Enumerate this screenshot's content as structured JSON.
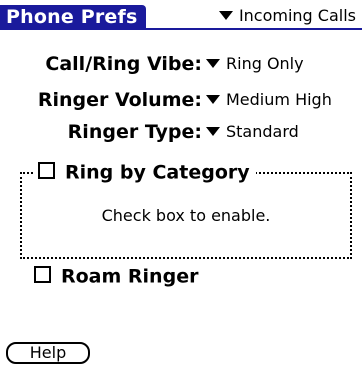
{
  "app": {
    "title": "Phone Prefs",
    "accent_color": "#1a1a9c"
  },
  "category_picker": {
    "value": "Incoming Calls",
    "icon": "dropdown-triangle-icon"
  },
  "settings": [
    {
      "label": "Call/Ring Vibe:",
      "value": "Ring Only"
    },
    {
      "label": "Ringer Volume:",
      "value": "Medium High"
    },
    {
      "label": "Ringer Type:",
      "value": "Standard"
    }
  ],
  "ring_by_category": {
    "label": "Ring by Category",
    "checked": false,
    "note": "Check box to enable."
  },
  "roam_ringer": {
    "label": "Roam Ringer",
    "checked": false
  },
  "help_button": {
    "label": "Help"
  }
}
